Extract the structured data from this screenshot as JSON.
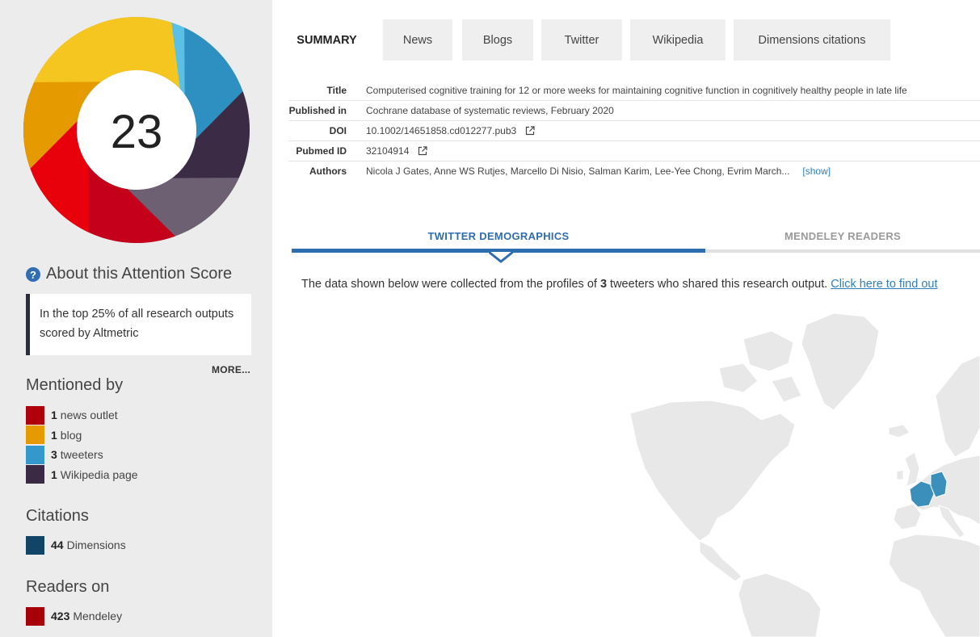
{
  "score": "23",
  "donut_colors": [
    "#5bc0e6",
    "#2e90c0",
    "#3b2b44",
    "#6e6073",
    "#c4001a",
    "#e8000a",
    "#e59a00",
    "#f5c520"
  ],
  "sidebar": {
    "about_icon": "question-icon",
    "about_label": "About this Attention Score",
    "score_text": "In the top 25% of all research outputs scored by Altmetric",
    "more_label": "MORE...",
    "mentioned_title": "Mentioned by",
    "mentions": [
      {
        "count": "1",
        "label": "news outlet",
        "color": "#b0000c"
      },
      {
        "count": "1",
        "label": "blog",
        "color": "#e69a00"
      },
      {
        "count": "3",
        "label": "tweeters",
        "color": "#3399cc"
      },
      {
        "count": "1",
        "label": "Wikipedia page",
        "color": "#3a2a44"
      }
    ],
    "citations_title": "Citations",
    "citations": {
      "count": "44",
      "label": "Dimensions",
      "color": "#114466"
    },
    "readers_title": "Readers on",
    "readers": {
      "count": "423",
      "label": "Mendeley",
      "color": "#a8000a"
    }
  },
  "tabs": [
    "SUMMARY",
    "News",
    "Blogs",
    "Twitter",
    "Wikipedia",
    "Dimensions citations"
  ],
  "meta": {
    "title_label": "Title",
    "title": "Computerised cognitive training for 12 or more weeks for maintaining cognitive function in cognitively healthy people in late life",
    "published_label": "Published in",
    "published": "Cochrane database of systematic reviews, February 2020",
    "doi_label": "DOI",
    "doi": "10.1002/14651858.cd012277.pub3",
    "pubmed_label": "Pubmed ID",
    "pubmed": "32104914",
    "authors_label": "Authors",
    "authors": "Nicola J Gates, Anne WS Rutjes, Marcello Di Nisio, Salman Karim, Lee-Yee Chong, Evrim March...",
    "show_label": "[show]",
    "external_icon": "external-link-icon"
  },
  "demographics": {
    "tab_active": "TWITTER DEMOGRAPHICS",
    "tab_inactive": "MENDELEY READERS",
    "desc_prefix": "The data shown below were collected from the profiles of ",
    "desc_count": "3",
    "desc_suffix": " tweeters who shared this research output. ",
    "desc_link": "Click here to find out",
    "highlight_color": "#3a8fbb"
  }
}
